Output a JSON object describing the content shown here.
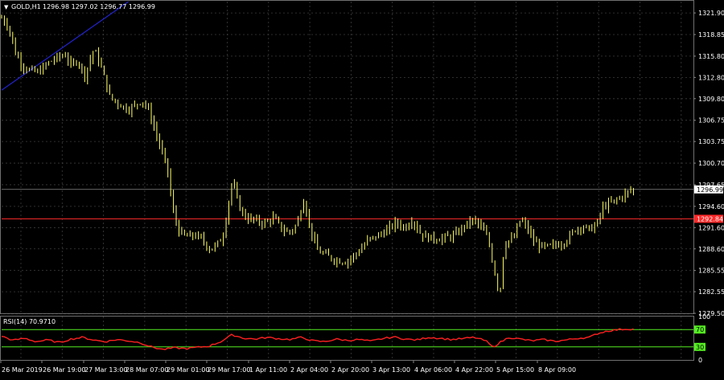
{
  "window": {
    "symbol_label": "GOLD,H1",
    "ohlc_label": "1296.98 1297.02 1296.77 1296.99"
  },
  "indicator": {
    "label": "RSI(14) 70.9710",
    "levels": [
      100,
      70,
      30,
      0
    ]
  },
  "colors": {
    "background": "#000000",
    "grid": "#3c3c3c",
    "candles": "#ffff66",
    "trendline": "#2222cc",
    "hline": "#ff2a2a",
    "rsi_line": "#ff2020",
    "rsi_levels": "#55ee22",
    "axis_text": "#ffffff"
  },
  "chart_data": [
    {
      "type": "candlestick",
      "title": "GOLD,H1",
      "price_ticks": [
        1321.9,
        1318.85,
        1315.8,
        1312.8,
        1309.8,
        1306.75,
        1303.75,
        1300.7,
        1297.65,
        1294.6,
        1291.6,
        1288.6,
        1285.55,
        1282.55,
        1279.5
      ],
      "ylim": [
        1279.5,
        1323.5
      ],
      "time_labels": [
        "26 Mar 2019",
        "26 Mar 19:00",
        "27 Mar 13:00",
        "28 Mar 07:00",
        "29 Mar 01:00",
        "29 Mar 17:00",
        "1 Apr 11:00",
        "2 Apr 04:00",
        "2 Apr 20:00",
        "3 Apr 13:00",
        "4 Apr 06:00",
        "4 Apr 22:00",
        "5 Apr 15:00",
        "8 Apr 09:00"
      ],
      "current_price": 1296.99,
      "current_price_label": "1296.99",
      "hline_price": 1292.84,
      "hline_label": "1292.84",
      "trendline": [
        {
          "t": 0,
          "price": 1311.0
        },
        {
          "t": 0.55,
          "price": 1323.5
        }
      ],
      "close_path": [
        [
          0,
          1321.2
        ],
        [
          0.03,
          1320.0
        ],
        [
          0.06,
          1316.3
        ],
        [
          0.09,
          1314.5
        ],
        [
          0.12,
          1313.8
        ],
        [
          0.16,
          1313.5
        ],
        [
          0.2,
          1314.8
        ],
        [
          0.24,
          1315.6
        ],
        [
          0.28,
          1316.0
        ],
        [
          0.3,
          1314.4
        ],
        [
          0.33,
          1315.3
        ],
        [
          0.36,
          1313.0
        ],
        [
          0.4,
          1316.8
        ],
        [
          0.43,
          1314.5
        ],
        [
          0.47,
          1310.0
        ],
        [
          0.52,
          1308.8
        ],
        [
          0.55,
          1308.3
        ],
        [
          0.58,
          1308.9
        ],
        [
          0.61,
          1309.6
        ],
        [
          0.64,
          1308.0
        ],
        [
          0.68,
          1303.8
        ],
        [
          0.72,
          1299.8
        ],
        [
          0.74,
          1294.4
        ],
        [
          0.77,
          1291.0
        ],
        [
          0.8,
          1290.3
        ],
        [
          0.84,
          1290.5
        ],
        [
          0.87,
          1289.9
        ],
        [
          0.9,
          1288.6
        ],
        [
          0.93,
          1289.0
        ],
        [
          0.96,
          1290.4
        ],
        [
          1.0,
          1298.2
        ],
        [
          1.03,
          1294.6
        ],
        [
          1.06,
          1293.0
        ],
        [
          1.1,
          1292.6
        ],
        [
          1.14,
          1292.2
        ],
        [
          1.18,
          1293.0
        ],
        [
          1.22,
          1291.2
        ],
        [
          1.25,
          1291.0
        ],
        [
          1.28,
          1292.0
        ],
        [
          1.31,
          1295.6
        ],
        [
          1.34,
          1291.2
        ],
        [
          1.37,
          1288.4
        ],
        [
          1.41,
          1287.6
        ],
        [
          1.45,
          1287.0
        ],
        [
          1.49,
          1286.8
        ],
        [
          1.52,
          1287.4
        ],
        [
          1.56,
          1288.6
        ],
        [
          1.59,
          1289.9
        ],
        [
          1.63,
          1290.4
        ],
        [
          1.67,
          1291.2
        ],
        [
          1.71,
          1292.3
        ],
        [
          1.75,
          1291.6
        ],
        [
          1.78,
          1292.8
        ],
        [
          1.82,
          1290.6
        ],
        [
          1.85,
          1290.2
        ],
        [
          1.89,
          1290.0
        ],
        [
          1.93,
          1290.2
        ],
        [
          1.97,
          1290.6
        ],
        [
          2.01,
          1292.0
        ],
        [
          2.05,
          1292.7
        ],
        [
          2.08,
          1291.6
        ],
        [
          2.11,
          1290.0
        ],
        [
          2.14,
          1285.0
        ],
        [
          2.16,
          1282.0
        ],
        [
          2.18,
          1289.5
        ],
        [
          2.22,
          1290.0
        ],
        [
          2.25,
          1292.8
        ],
        [
          2.28,
          1291.5
        ],
        [
          2.31,
          1289.5
        ],
        [
          2.35,
          1288.8
        ],
        [
          2.39,
          1289.0
        ],
        [
          2.43,
          1289.4
        ],
        [
          2.46,
          1290.2
        ],
        [
          2.49,
          1291.5
        ],
        [
          2.52,
          1291.8
        ],
        [
          2.55,
          1291.3
        ],
        [
          2.58,
          1292.0
        ],
        [
          2.61,
          1294.6
        ],
        [
          2.65,
          1295.2
        ],
        [
          2.69,
          1296.0
        ],
        [
          2.72,
          1296.7
        ],
        [
          2.74,
          1296.99
        ]
      ],
      "series": [
        {
          "name": "RSI(14)",
          "ylim": [
            0,
            100
          ],
          "levels": [
            70,
            30
          ],
          "points": [
            [
              0,
              55
            ],
            [
              0.05,
              45
            ],
            [
              0.1,
              50
            ],
            [
              0.15,
              42
            ],
            [
              0.2,
              46
            ],
            [
              0.25,
              40
            ],
            [
              0.3,
              48
            ],
            [
              0.35,
              52
            ],
            [
              0.4,
              46
            ],
            [
              0.45,
              42
            ],
            [
              0.5,
              47
            ],
            [
              0.55,
              44
            ],
            [
              0.6,
              40
            ],
            [
              0.65,
              30
            ],
            [
              0.7,
              24
            ],
            [
              0.75,
              28
            ],
            [
              0.8,
              26
            ],
            [
              0.85,
              29
            ],
            [
              0.9,
              32
            ],
            [
              0.95,
              42
            ],
            [
              1.0,
              58
            ],
            [
              1.05,
              50
            ],
            [
              1.1,
              48
            ],
            [
              1.15,
              52
            ],
            [
              1.2,
              49
            ],
            [
              1.25,
              47
            ],
            [
              1.3,
              52
            ],
            [
              1.35,
              44
            ],
            [
              1.4,
              42
            ],
            [
              1.45,
              48
            ],
            [
              1.5,
              45
            ],
            [
              1.55,
              47
            ],
            [
              1.6,
              43
            ],
            [
              1.65,
              49
            ],
            [
              1.7,
              53
            ],
            [
              1.75,
              48
            ],
            [
              1.8,
              46
            ],
            [
              1.85,
              52
            ],
            [
              1.9,
              50
            ],
            [
              1.95,
              47
            ],
            [
              2.0,
              49
            ],
            [
              2.05,
              52
            ],
            [
              2.1,
              44
            ],
            [
              2.13,
              29
            ],
            [
              2.16,
              40
            ],
            [
              2.2,
              52
            ],
            [
              2.25,
              48
            ],
            [
              2.3,
              44
            ],
            [
              2.35,
              47
            ],
            [
              2.4,
              43
            ],
            [
              2.45,
              46
            ],
            [
              2.5,
              50
            ],
            [
              2.55,
              52
            ],
            [
              2.58,
              60
            ],
            [
              2.62,
              66
            ],
            [
              2.66,
              69
            ],
            [
              2.7,
              71
            ],
            [
              2.74,
              70.97
            ]
          ]
        }
      ]
    }
  ]
}
